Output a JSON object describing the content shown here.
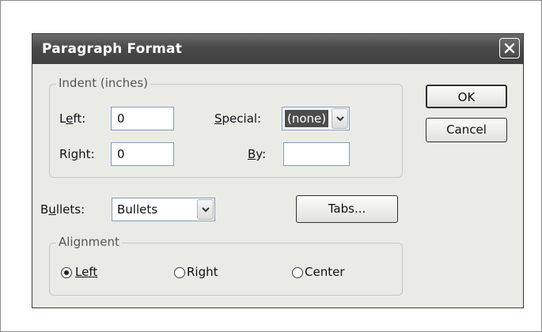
{
  "dialog": {
    "title": "Paragraph Format",
    "indent_group": {
      "legend": "Indent (inches)",
      "left_label": "Left:",
      "left_value": "0",
      "right_label": "Right:",
      "right_value": "0",
      "special_label": "Special:",
      "special_value": "(none)",
      "by_label": "By:",
      "by_value": ""
    },
    "bullets_label": "Bullets:",
    "bullets_value": "Bullets",
    "tabs_button": "Tabs...",
    "alignment_group": {
      "legend": "Alignment",
      "options": [
        {
          "label": "Left",
          "selected": true
        },
        {
          "label": "Right",
          "selected": false
        },
        {
          "label": "Center",
          "selected": false
        }
      ]
    },
    "ok_button": "OK",
    "cancel_button": "Cancel"
  },
  "icons": {
    "close": "close-icon",
    "dropdown": "chevron-down-icon"
  },
  "colors": {
    "titlebar": "#4a4a4a",
    "dialog_bg": "#ebebe6",
    "field_border": "#7f9db9",
    "selection": "#4d4d4d"
  }
}
